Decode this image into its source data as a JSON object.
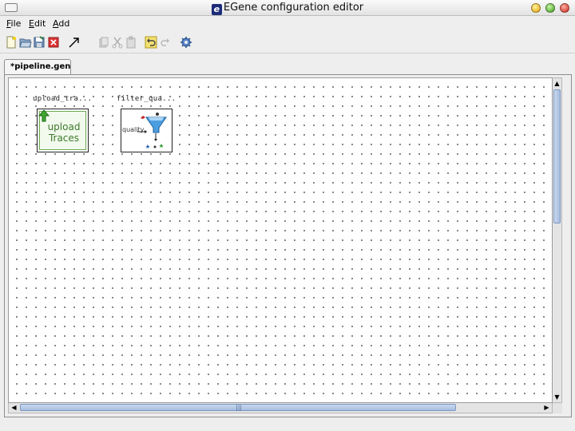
{
  "window": {
    "title": "EGene configuration editor",
    "logo_letter": "e"
  },
  "menu": {
    "items": [
      {
        "label": "File",
        "mnemonic": "F",
        "rest": "ile"
      },
      {
        "label": "Edit",
        "mnemonic": "E",
        "rest": "dit"
      },
      {
        "label": "Add",
        "mnemonic": "A",
        "rest": "dd"
      }
    ]
  },
  "toolbar": {
    "icons": [
      "new-file-icon",
      "open-folder-icon",
      "save-icon",
      "close-red-icon",
      "pointer-arrow-icon",
      "copy-icon",
      "cut-icon",
      "paste-icon",
      "undo-icon",
      "redo-icon",
      "gear-icon"
    ]
  },
  "tabs": [
    {
      "label": "*pipeline.gen",
      "selected": true
    }
  ],
  "canvas": {
    "nodes": [
      {
        "label": "upload_tra...",
        "image_text": "upload Traces"
      },
      {
        "label": "filter_qua...",
        "image_text": "quality"
      }
    ]
  },
  "scrollbars": {
    "horizontal_grip": "|||"
  },
  "colors": {
    "accent": "#a7bedf",
    "upload_green": "#3e7a2a",
    "filter_blue": "#3a8fd6"
  }
}
